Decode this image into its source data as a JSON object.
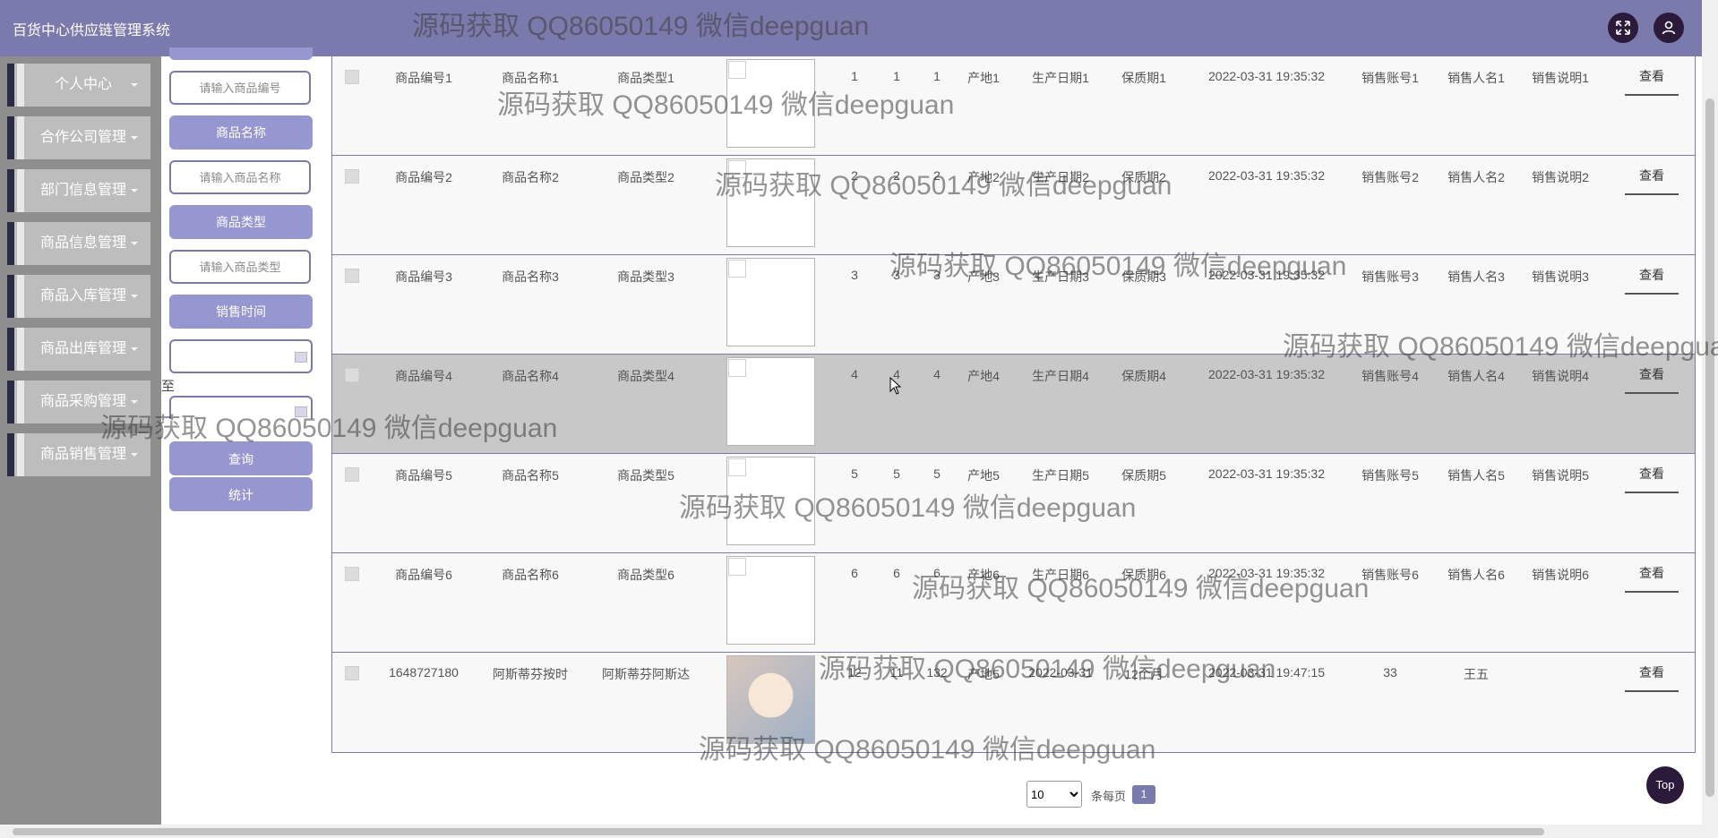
{
  "header": {
    "title": "百货中心供应链管理系统"
  },
  "sidebar": {
    "items": [
      {
        "label": "个人中心"
      },
      {
        "label": "合作公司管理"
      },
      {
        "label": "部门信息管理"
      },
      {
        "label": "商品信息管理"
      },
      {
        "label": "商品入库管理"
      },
      {
        "label": "商品出库管理"
      },
      {
        "label": "商品采购管理"
      },
      {
        "label": "商品销售管理"
      }
    ]
  },
  "filters": {
    "code_placeholder": "请输入商品编号",
    "name_label": "商品名称",
    "name_placeholder": "请输入商品名称",
    "type_label": "商品类型",
    "type_placeholder": "请输入商品类型",
    "time_label": "销售时间",
    "range_sep": "至",
    "query_button": "查询",
    "stats_button": "统计"
  },
  "table": {
    "action_label": "查看",
    "rows": [
      {
        "code": "商品编号1",
        "name": "商品名称1",
        "type": "商品类型1",
        "n1": "1",
        "n2": "1",
        "n3": "1",
        "origin": "产地1",
        "mfg": "生产日期1",
        "shelf": "保质期1",
        "time": "2022-03-31 19:35:32",
        "account": "销售账号1",
        "person": "销售人名1",
        "note": "销售说明1",
        "image": "broken"
      },
      {
        "code": "商品编号2",
        "name": "商品名称2",
        "type": "商品类型2",
        "n1": "2",
        "n2": "2",
        "n3": "2",
        "origin": "产地2",
        "mfg": "生产日期2",
        "shelf": "保质期2",
        "time": "2022-03-31 19:35:32",
        "account": "销售账号2",
        "person": "销售人名2",
        "note": "销售说明2",
        "image": "broken"
      },
      {
        "code": "商品编号3",
        "name": "商品名称3",
        "type": "商品类型3",
        "n1": "3",
        "n2": "3",
        "n3": "3",
        "origin": "产地3",
        "mfg": "生产日期3",
        "shelf": "保质期3",
        "time": "2022-03-31 19:35:32",
        "account": "销售账号3",
        "person": "销售人名3",
        "note": "销售说明3",
        "image": "broken"
      },
      {
        "code": "商品编号4",
        "name": "商品名称4",
        "type": "商品类型4",
        "n1": "4",
        "n2": "4",
        "n3": "4",
        "origin": "产地4",
        "mfg": "生产日期4",
        "shelf": "保质期4",
        "time": "2022-03-31 19:35:32",
        "account": "销售账号4",
        "person": "销售人名4",
        "note": "销售说明4",
        "image": "broken"
      },
      {
        "code": "商品编号5",
        "name": "商品名称5",
        "type": "商品类型5",
        "n1": "5",
        "n2": "5",
        "n3": "5",
        "origin": "产地5",
        "mfg": "生产日期5",
        "shelf": "保质期5",
        "time": "2022-03-31 19:35:32",
        "account": "销售账号5",
        "person": "销售人名5",
        "note": "销售说明5",
        "image": "broken"
      },
      {
        "code": "商品编号6",
        "name": "商品名称6",
        "type": "商品类型6",
        "n1": "6",
        "n2": "6",
        "n3": "6",
        "origin": "产地6",
        "mfg": "生产日期6",
        "shelf": "保质期6",
        "time": "2022-03-31 19:35:32",
        "account": "销售账号6",
        "person": "销售人名6",
        "note": "销售说明6",
        "image": "broken"
      },
      {
        "code": "1648727180",
        "name": "阿斯蒂芬按时",
        "type": "阿斯蒂芬阿斯达",
        "n1": "12",
        "n2": "11",
        "n3": "132",
        "origin": "产地5",
        "mfg": "2022-03-31",
        "shelf": "12个月",
        "time": "2022-03-31 19:47:15",
        "account": "33",
        "person": "王五",
        "note": "",
        "image": "photo"
      }
    ]
  },
  "pagination": {
    "page_size": "10",
    "page_size_options": [
      "10"
    ],
    "per_page_label": "条每页",
    "current_page": "1"
  },
  "top_button": "Top",
  "watermark": "源码获取 QQ86050149 微信deepguan",
  "colors": {
    "header_bg": "#7a7aac",
    "sidebar_bg": "#8e8e8e",
    "button_bg": "#9696d1",
    "dark_accent": "#2c1a3b"
  }
}
